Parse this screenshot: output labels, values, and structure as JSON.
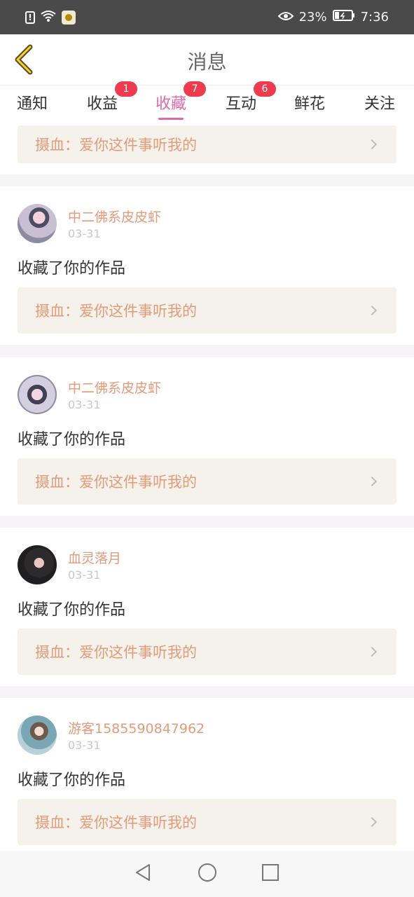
{
  "status_bar": {
    "battery": "23%",
    "time": "7:36"
  },
  "header": {
    "title": "消息"
  },
  "tabs": [
    {
      "label": "通知",
      "badge": "",
      "active": false
    },
    {
      "label": "收益",
      "badge": "1",
      "active": false
    },
    {
      "label": "收藏",
      "badge": "7",
      "active": true
    },
    {
      "label": "互动",
      "badge": "6",
      "active": false
    },
    {
      "label": "鲜花",
      "badge": "",
      "active": false
    },
    {
      "label": "关注",
      "badge": "",
      "active": false
    }
  ],
  "partial_item": {
    "work_title": "摄血：爱你这件事听我的"
  },
  "items": [
    {
      "name": "中二佛系皮皮虾",
      "date": "03-31",
      "action": "收藏了你的作品",
      "work_title": "摄血：爱你这件事听我的"
    },
    {
      "name": "中二佛系皮皮虾",
      "date": "03-31",
      "action": "收藏了你的作品",
      "work_title": "摄血：爱你这件事听我的"
    },
    {
      "name": "血灵落月",
      "date": "03-31",
      "action": "收藏了你的作品",
      "work_title": "摄血：爱你这件事听我的"
    },
    {
      "name": "游客1585590847962",
      "date": "03-31",
      "action": "收藏了你的作品",
      "work_title": "摄血：爱你这件事听我的"
    }
  ],
  "colors": {
    "accent_pink": "#e06aa8",
    "name_orange": "#e39a7a",
    "badge_red": "#ef3b4f",
    "link_bg": "#f4f2ea"
  }
}
